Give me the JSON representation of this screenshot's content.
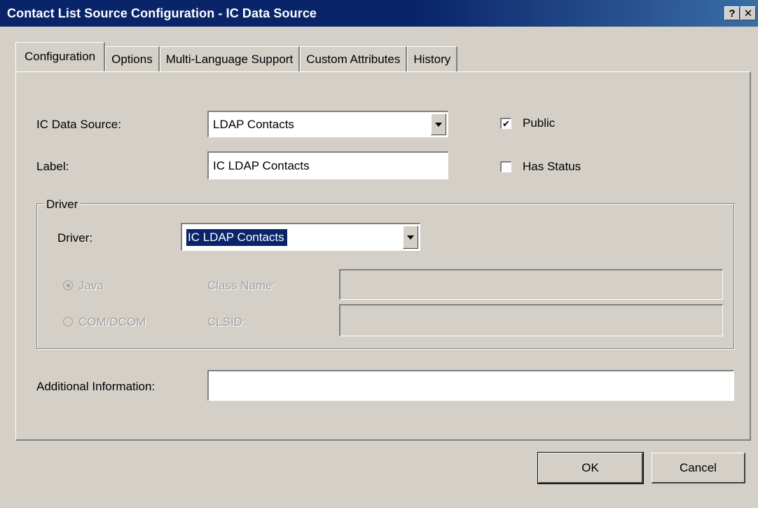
{
  "window": {
    "title": "Contact List Source Configuration - IC Data Source",
    "help_glyph": "?",
    "close_glyph": "✕"
  },
  "tabs": [
    {
      "label": "Configuration",
      "active": true
    },
    {
      "label": "Options",
      "active": false
    },
    {
      "label": "Multi-Language Support",
      "active": false
    },
    {
      "label": "Custom Attributes",
      "active": false
    },
    {
      "label": "History",
      "active": false
    }
  ],
  "form": {
    "ic_data_source_label": "IC Data Source:",
    "ic_data_source_value": "LDAP Contacts",
    "label_label": "Label:",
    "label_value": "IC LDAP Contacts",
    "public_label": "Public",
    "public_checked": true,
    "has_status_label": "Has Status",
    "has_status_checked": false,
    "check_glyph": "✔"
  },
  "driver_group": {
    "title": "Driver",
    "driver_label": "Driver:",
    "driver_value": "IC LDAP Contacts",
    "java_label": "Java",
    "java_selected": true,
    "com_label": "COM/DCOM",
    "com_selected": false,
    "class_name_label": "Class Name:",
    "class_name_value": "",
    "clsid_label": "CLSID:",
    "clsid_value": ""
  },
  "additional_info": {
    "label": "Additional Information:",
    "value": ""
  },
  "buttons": {
    "ok": "OK",
    "cancel": "Cancel"
  }
}
